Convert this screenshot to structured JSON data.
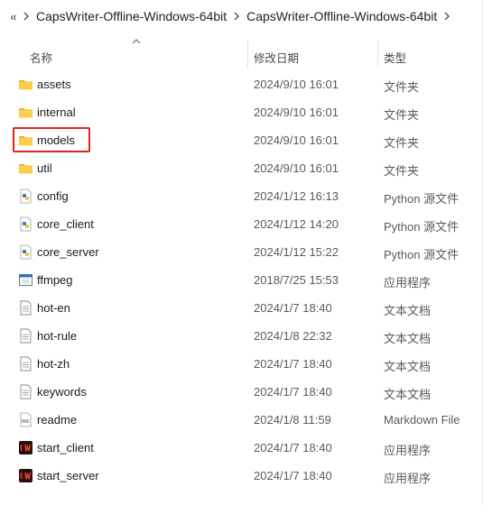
{
  "breadcrumb": {
    "overflow": "«",
    "items": [
      "CapsWriter-Offline-Windows-64bit",
      "CapsWriter-Offline-Windows-64bit"
    ]
  },
  "columns": {
    "name": "名称",
    "date": "修改日期",
    "type": "类型"
  },
  "files": [
    {
      "name": "assets",
      "date": "2024/9/10 16:01",
      "type": "文件夹",
      "icon": "folder-icon"
    },
    {
      "name": "internal",
      "date": "2024/9/10 16:01",
      "type": "文件夹",
      "icon": "folder-icon"
    },
    {
      "name": "models",
      "date": "2024/9/10 16:01",
      "type": "文件夹",
      "icon": "folder-icon"
    },
    {
      "name": "util",
      "date": "2024/9/10 16:01",
      "type": "文件夹",
      "icon": "folder-icon"
    },
    {
      "name": "config",
      "date": "2024/1/12 16:13",
      "type": "Python 源文件",
      "icon": "python-file-icon"
    },
    {
      "name": "core_client",
      "date": "2024/1/12 14:20",
      "type": "Python 源文件",
      "icon": "python-file-icon"
    },
    {
      "name": "core_server",
      "date": "2024/1/12 15:22",
      "type": "Python 源文件",
      "icon": "python-file-icon"
    },
    {
      "name": "ffmpeg",
      "date": "2018/7/25 15:53",
      "type": "应用程序",
      "icon": "exe-icon"
    },
    {
      "name": "hot-en",
      "date": "2024/1/7 18:40",
      "type": "文本文档",
      "icon": "text-file-icon"
    },
    {
      "name": "hot-rule",
      "date": "2024/1/8 22:32",
      "type": "文本文档",
      "icon": "text-file-icon"
    },
    {
      "name": "hot-zh",
      "date": "2024/1/7 18:40",
      "type": "文本文档",
      "icon": "text-file-icon"
    },
    {
      "name": "keywords",
      "date": "2024/1/7 18:40",
      "type": "文本文档",
      "icon": "text-file-icon"
    },
    {
      "name": "readme",
      "date": "2024/1/8 11:59",
      "type": "Markdown File",
      "icon": "markdown-file-icon"
    },
    {
      "name": "start_client",
      "date": "2024/1/7 18:40",
      "type": "应用程序",
      "icon": "capswriter-app-icon"
    },
    {
      "name": "start_server",
      "date": "2024/1/7 18:40",
      "type": "应用程序",
      "icon": "capswriter-app-icon"
    }
  ],
  "colors": {
    "folder": "#f4c542",
    "highlight": "#e02424",
    "app_icon_bg": "#b3261e"
  }
}
